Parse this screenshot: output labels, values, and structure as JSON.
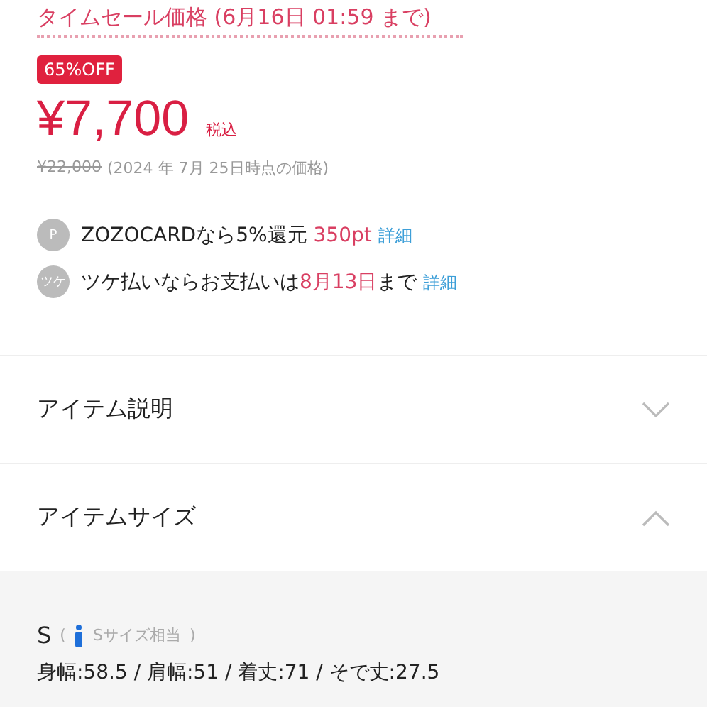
{
  "sale_deadline": "タイムセール価格 (6月16日 01:59 まで)",
  "discount_badge": "65%OFF",
  "price": {
    "amount": "¥7,700",
    "tax_note": "税込"
  },
  "reference_price": {
    "old_price": "¥22,000",
    "note": "(2024 年 7月 25日時点の価格)"
  },
  "benefits": [
    {
      "icon_label": "P",
      "parts": [
        {
          "kind": "plain",
          "text": "ZOZOCARDなら5%還元 "
        },
        {
          "kind": "accent",
          "text": "350pt"
        }
      ],
      "link": "詳細"
    },
    {
      "icon_label": "ツケ",
      "parts": [
        {
          "kind": "plain",
          "text": "ツケ払いならお支払いは"
        },
        {
          "kind": "accent",
          "text": "8月13日"
        },
        {
          "kind": "plain",
          "text": "まで"
        }
      ],
      "link": "詳細"
    }
  ],
  "sections": [
    {
      "title": "アイテム説明",
      "expanded": false
    },
    {
      "title": "アイテムサイズ",
      "expanded": true
    }
  ],
  "size_panel": {
    "size": "S",
    "paren_open": "(",
    "equivalent": "Sサイズ相当",
    "paren_close": ")",
    "measurements": "身幅:58.5 / 肩幅:51 / 着丈:71 / そで丈:27.5"
  }
}
